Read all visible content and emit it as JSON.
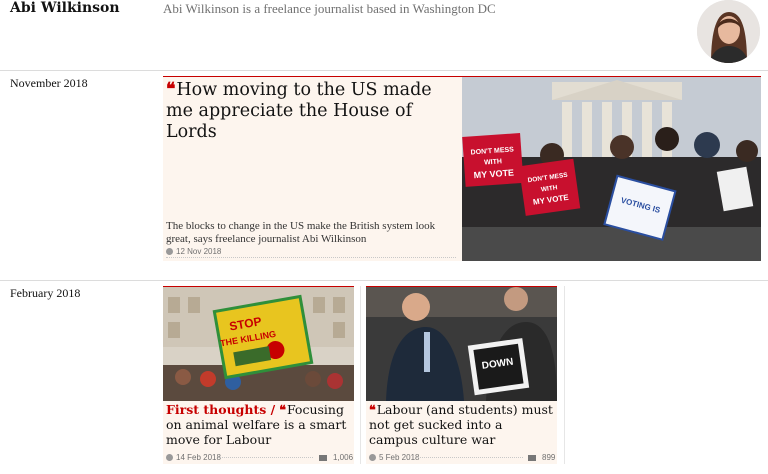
{
  "profile": {
    "name": "Abi Wilkinson",
    "bio": "Abi Wilkinson is a freelance journalist based in Washington DC"
  },
  "sections": [
    {
      "date": "November 2018",
      "feature": {
        "headline": "How moving to the US made me appreciate the House of Lords",
        "standfirst": "The blocks to change in the US make the British system look great, says freelance journalist Abi Wilkinson",
        "timestamp": "12 Nov 2018",
        "image_signs": [
          "DON'T MESS WITH MY VOTE",
          "DON'T MESS WITH MY VOTE",
          "VOTING IS"
        ]
      }
    },
    {
      "date": "February 2018",
      "cards": [
        {
          "kicker": "First thoughts /",
          "headline": "Focusing on animal welfare is a smart move for Labour",
          "timestamp": "14 Feb 2018",
          "comments": "1,006",
          "image_sign": "STOP THE KILLING"
        },
        {
          "kicker": "",
          "headline": "Labour (and students) must not get sucked into a campus culture war",
          "timestamp": "5 Feb 2018",
          "comments": "899",
          "image_sign": "DOWN"
        }
      ]
    }
  ],
  "colors": {
    "accent": "#c70000",
    "card_background": "#fdf5ee",
    "rule": "#dcdcdc",
    "meta_text": "#707070"
  },
  "icons": {
    "quote": "quote-icon",
    "clock": "clock-icon",
    "comment": "comment-icon"
  }
}
